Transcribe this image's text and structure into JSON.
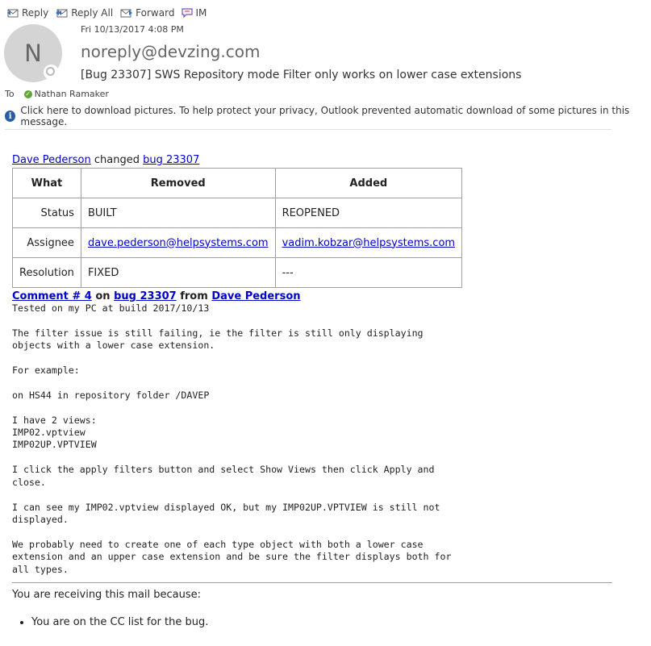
{
  "toolbar": {
    "reply": "Reply",
    "reply_all": "Reply All",
    "forward": "Forward",
    "im": "IM"
  },
  "header": {
    "avatar_initial": "N",
    "date": "Fri 10/13/2017 4:08 PM",
    "sender": "noreply@devzing.com",
    "subject": "[Bug 23307] SWS Repository mode Filter only works on lower case extensions",
    "to_label": "To",
    "recipient": "Nathan Ramaker"
  },
  "info_bar": {
    "text": "Click here to download pictures. To help protect your privacy, Outlook prevented automatic download of some pictures in this message."
  },
  "change": {
    "author": "Dave Pederson",
    "verb": " changed ",
    "bug_link": "bug 23307"
  },
  "table": {
    "headers": [
      "What",
      "Removed",
      "Added"
    ],
    "rows": [
      {
        "what": "Status",
        "removed": "BUILT",
        "added": "REOPENED"
      },
      {
        "what": "Assignee",
        "removed": "dave.pederson@helpsystems.com",
        "added": "vadim.kobzar@helpsystems.com"
      },
      {
        "what": "Resolution",
        "removed": "FIXED",
        "added": "---"
      }
    ]
  },
  "comment": {
    "comment_link": "Comment # 4",
    "on": " on ",
    "bug_link": "bug 23307",
    "from": " from ",
    "author": "Dave Pederson",
    "body": "Tested on my PC at build 2017/10/13\n\nThe filter issue is still failing, ie the filter is still only displaying\nobjects with a lower case extension.\n\nFor example:\n\non HS44 in repository folder /DAVEP\n\nI have 2 views:\nIMP02.vptview\nIMP02UP.VPTVIEW\n\nI click the apply filters button and select Show Views then click Apply and\nclose.\n\nI can see my IMP02.vptview displayed OK, but my IMP02UP.VPTVIEW is still not\ndisplayed.\n\nWe probably need to create one of each type object with both a lower case\nextension and an upper case extension and be sure the filter displays both for\nall types."
  },
  "footer": {
    "reason_intro": "You are receiving this mail because:",
    "reasons": [
      "You are on the CC list for the bug."
    ]
  }
}
